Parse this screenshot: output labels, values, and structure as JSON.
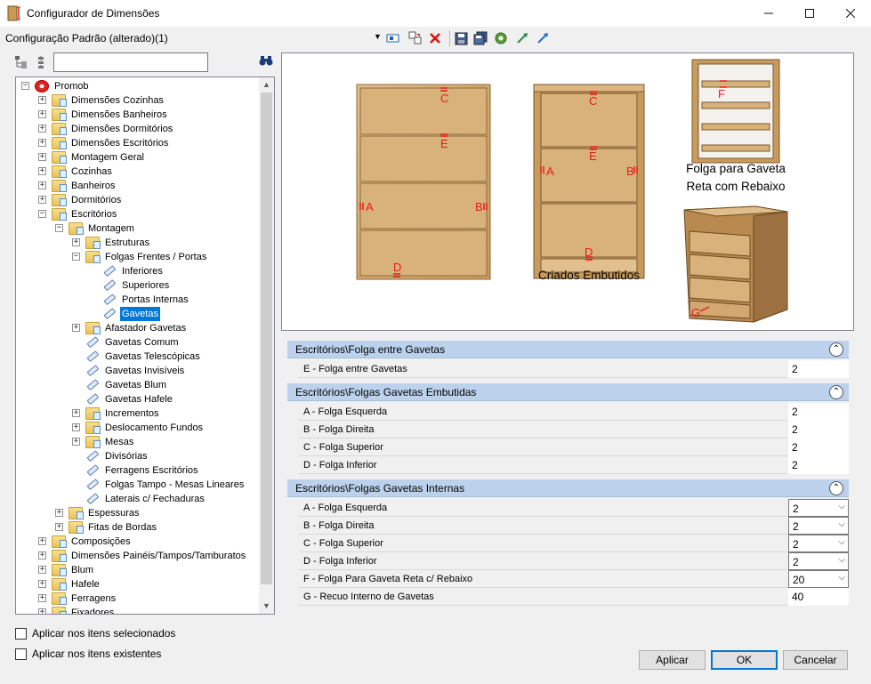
{
  "window": {
    "title": "Configurador de Dimensões",
    "min_icon": "minimize-icon",
    "max_icon": "maximize-icon",
    "close_icon": "close-icon"
  },
  "config": {
    "name": "Configuração Padrão (alterado)(1)"
  },
  "toolbar": {
    "icons": [
      "select-icon",
      "copy-config-icon",
      "delete-icon",
      "save-icon",
      "save-all-icon",
      "refresh-icon",
      "import-icon",
      "export-icon"
    ]
  },
  "tree_toolbar": {
    "search_value": "",
    "search_placeholder": ""
  },
  "tree": [
    {
      "label": "Promob",
      "level": 0,
      "expander": "−",
      "icon": "root"
    },
    {
      "label": "Dimensões Cozinhas",
      "level": 1,
      "expander": "+",
      "icon": "folder"
    },
    {
      "label": "Dimensões Banheiros",
      "level": 1,
      "expander": "+",
      "icon": "folder"
    },
    {
      "label": "Dimensões Dormitórios",
      "level": 1,
      "expander": "+",
      "icon": "folder"
    },
    {
      "label": "Dimensões Escritórios",
      "level": 1,
      "expander": "+",
      "icon": "folder"
    },
    {
      "label": "Montagem Geral",
      "level": 1,
      "expander": "+",
      "icon": "folder"
    },
    {
      "label": "Cozinhas",
      "level": 1,
      "expander": "+",
      "icon": "folder"
    },
    {
      "label": "Banheiros",
      "level": 1,
      "expander": "+",
      "icon": "folder"
    },
    {
      "label": "Dormitórios",
      "level": 1,
      "expander": "+",
      "icon": "folder"
    },
    {
      "label": "Escritórios",
      "level": 1,
      "expander": "−",
      "icon": "folder"
    },
    {
      "label": "Montagem",
      "level": 2,
      "expander": "−",
      "icon": "folder"
    },
    {
      "label": "Estruturas",
      "level": 3,
      "expander": "+",
      "icon": "folder"
    },
    {
      "label": "Folgas Frentes / Portas",
      "level": 3,
      "expander": "−",
      "icon": "folder"
    },
    {
      "label": "Inferiores",
      "level": 4,
      "expander": "",
      "icon": "tag"
    },
    {
      "label": "Superiores",
      "level": 4,
      "expander": "",
      "icon": "tag"
    },
    {
      "label": "Portas Internas",
      "level": 4,
      "expander": "",
      "icon": "tag"
    },
    {
      "label": "Gavetas",
      "level": 4,
      "expander": "",
      "icon": "tag",
      "selected": true
    },
    {
      "label": "Afastador Gavetas",
      "level": 3,
      "expander": "+",
      "icon": "folder"
    },
    {
      "label": "Gavetas Comum",
      "level": 3,
      "expander": "",
      "icon": "tag"
    },
    {
      "label": "Gavetas Telescópicas",
      "level": 3,
      "expander": "",
      "icon": "tag"
    },
    {
      "label": "Gavetas Invisíveis",
      "level": 3,
      "expander": "",
      "icon": "tag"
    },
    {
      "label": "Gavetas Blum",
      "level": 3,
      "expander": "",
      "icon": "tag"
    },
    {
      "label": " Gavetas Hafele",
      "level": 3,
      "expander": "",
      "icon": "tag"
    },
    {
      "label": "Incrementos",
      "level": 3,
      "expander": "+",
      "icon": "folder"
    },
    {
      "label": "Deslocamento Fundos",
      "level": 3,
      "expander": "+",
      "icon": "folder"
    },
    {
      "label": "Mesas",
      "level": 3,
      "expander": "+",
      "icon": "folder"
    },
    {
      "label": "Divisórias",
      "level": 3,
      "expander": "",
      "icon": "tag"
    },
    {
      "label": "Ferragens Escritórios",
      "level": 3,
      "expander": "",
      "icon": "tag"
    },
    {
      "label": "Folgas Tampo - Mesas Lineares",
      "level": 3,
      "expander": "",
      "icon": "tag"
    },
    {
      "label": "Laterais c/ Fechaduras",
      "level": 3,
      "expander": "",
      "icon": "tag"
    },
    {
      "label": "Espessuras",
      "level": 2,
      "expander": "+",
      "icon": "folder"
    },
    {
      "label": "Fitas de Bordas",
      "level": 2,
      "expander": "+",
      "icon": "folder"
    },
    {
      "label": "Composições",
      "level": 1,
      "expander": "+",
      "icon": "folder"
    },
    {
      "label": "Dimensões Painéis/Tampos/Tamburatos",
      "level": 1,
      "expander": "+",
      "icon": "folder"
    },
    {
      "label": "Blum",
      "level": 1,
      "expander": "+",
      "icon": "folder"
    },
    {
      "label": "Hafele",
      "level": 1,
      "expander": "+",
      "icon": "folder"
    },
    {
      "label": "Ferragens",
      "level": 1,
      "expander": "+",
      "icon": "folder"
    },
    {
      "label": "Fixadores",
      "level": 1,
      "expander": "+",
      "icon": "folder"
    }
  ],
  "options": {
    "apply_selected": "Aplicar nos itens selecionados",
    "apply_existing": "Aplicar nos itens existentes"
  },
  "image": {
    "caption_embutidos": "Criados Embutidos",
    "caption_rebaixo_1": "Folga para Gaveta",
    "caption_rebaixo_2": "Reta com Rebaixo",
    "letters": {
      "a": "A",
      "b": "B",
      "c": "C",
      "d": "D",
      "e": "E",
      "f": "F",
      "g": "G"
    },
    "wood_color": "#d8b27a",
    "marker_color": "#e31d1d"
  },
  "grid": {
    "cat1": {
      "label": "Escritórios\\Folga entre Gavetas",
      "rows": [
        {
          "name": "E - Folga entre Gavetas",
          "value": "2"
        }
      ]
    },
    "cat2": {
      "label": "Escritórios\\Folgas Gavetas Embutidas",
      "rows": [
        {
          "name": "A - Folga Esquerda",
          "value": "2"
        },
        {
          "name": "B - Folga Direita",
          "value": "2"
        },
        {
          "name": "C - Folga Superior",
          "value": "2"
        },
        {
          "name": "D - Folga Inferior",
          "value": "2"
        }
      ]
    },
    "cat3": {
      "label": "Escritórios\\Folgas Gavetas Internas",
      "rows": [
        {
          "name": "A - Folga Esquerda",
          "value": "2"
        },
        {
          "name": "B - Folga Direita",
          "value": "2"
        },
        {
          "name": "C - Folga Superior",
          "value": "2"
        },
        {
          "name": "D - Folga Inferior",
          "value": "2"
        },
        {
          "name": "F - Folga Para Gaveta Reta c/ Rebaixo",
          "value": "20"
        },
        {
          "name": "G - Recuo Interno de Gavetas",
          "value": "40"
        }
      ]
    }
  },
  "buttons": {
    "apply": "Aplicar",
    "ok": "OK",
    "cancel": "Cancelar"
  }
}
